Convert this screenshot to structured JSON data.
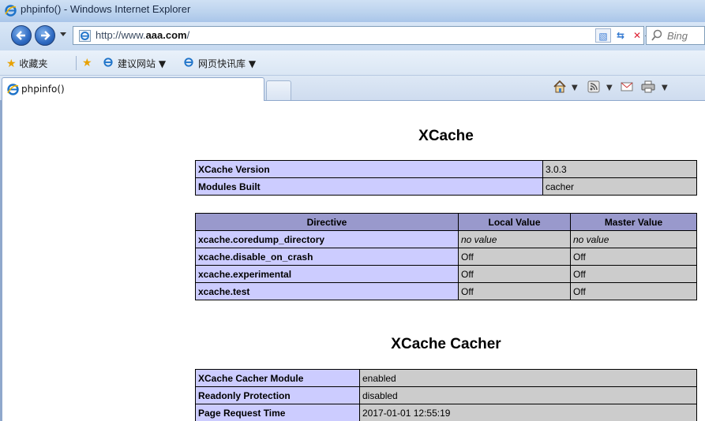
{
  "window": {
    "title": "phpinfo() - Windows Internet Explorer"
  },
  "navigation": {
    "address_prefix": "http://www.",
    "address_domain": "aaa.com",
    "address_suffix": "/",
    "search_placeholder": "Bing"
  },
  "favorites_bar": {
    "favorites_label": "收藏夹",
    "items": [
      {
        "label": "建议网站 ▼"
      },
      {
        "label": "网页快讯库 ▼"
      }
    ]
  },
  "tabs": [
    {
      "label": "phpinfo()"
    }
  ],
  "page": {
    "section1_title": "XCache",
    "info_table": [
      {
        "key": "XCache Version",
        "value": "3.0.3"
      },
      {
        "key": "Modules Built",
        "value": "cacher"
      }
    ],
    "directive_headers": [
      "Directive",
      "Local Value",
      "Master Value"
    ],
    "directives": [
      {
        "name": "xcache.coredump_directory",
        "local": "no value",
        "master": "no value"
      },
      {
        "name": "xcache.disable_on_crash",
        "local": "Off",
        "master": "Off"
      },
      {
        "name": "xcache.experimental",
        "local": "Off",
        "master": "Off"
      },
      {
        "name": "xcache.test",
        "local": "Off",
        "master": "Off"
      }
    ],
    "section2_title": "XCache Cacher",
    "cacher_table": [
      {
        "key": "XCache Cacher Module",
        "value": "enabled"
      },
      {
        "key": "Readonly Protection",
        "value": "disabled"
      },
      {
        "key": "Page Request Time",
        "value": "2017-01-01 12:55:19"
      }
    ]
  },
  "colors": {
    "php_key_bg": "#ccccff",
    "php_value_bg": "#cccccc",
    "php_header_bg": "#9999cc"
  }
}
